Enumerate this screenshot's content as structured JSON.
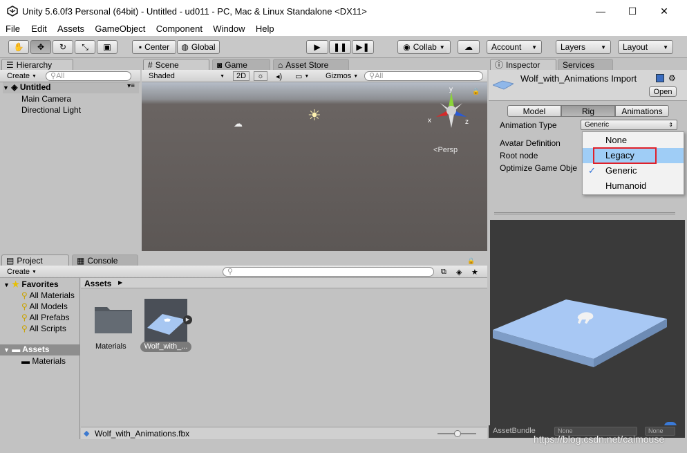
{
  "window": {
    "title": "Unity 5.6.0f3 Personal (64bit) - Untitled - ud011 - PC, Mac & Linux Standalone <DX11>",
    "minimize": "—",
    "maximize": "☐",
    "close": "✕"
  },
  "menu": [
    "File",
    "Edit",
    "Assets",
    "GameObject",
    "Component",
    "Window",
    "Help"
  ],
  "toolbar": {
    "center": "Center",
    "global": "Global",
    "collab": "Collab",
    "account": "Account",
    "layers": "Layers",
    "layout": "Layout"
  },
  "hierarchy": {
    "tab": "Hierarchy",
    "create": "Create",
    "search_placeholder": "All",
    "scene": "Untitled",
    "items": [
      "Main Camera",
      "Directional Light"
    ]
  },
  "scene": {
    "tabs": [
      "Scene",
      "Game",
      "Asset Store"
    ],
    "shading": "Shaded",
    "mode2d": "2D",
    "gizmos": "Gizmos",
    "search_placeholder": "All",
    "persp": "Persp",
    "axes": {
      "x": "x",
      "y": "y",
      "z": "z"
    }
  },
  "inspector": {
    "tabs": [
      "Inspector",
      "Services"
    ],
    "asset_title": "Wolf_with_Animations Import",
    "open": "Open",
    "subtabs": [
      "Model",
      "Rig",
      "Animations"
    ],
    "active_subtab": "Rig",
    "rows": [
      "Animation Type",
      "Avatar Definition",
      "Root node",
      "Optimize Game Obje"
    ],
    "animation_type_value": "Generic",
    "dropdown": {
      "options": [
        "None",
        "Legacy",
        "Generic",
        "Humanoid"
      ],
      "highlighted": "Legacy",
      "checked": "Generic"
    },
    "assetbundle": {
      "label": "AssetBundle",
      "value": "None",
      "variant": "None"
    }
  },
  "project": {
    "tabs": [
      "Project",
      "Console"
    ],
    "create": "Create",
    "favorites": "Favorites",
    "fav_items": [
      "All Materials",
      "All Models",
      "All Prefabs",
      "All Scripts"
    ],
    "assets": "Assets",
    "asset_children": [
      "Materials"
    ],
    "breadcrumb": "Assets",
    "grid": [
      {
        "label": "Materials"
      },
      {
        "label": "Wolf_with_..."
      }
    ],
    "footer": "Wolf_with_Animations.fbx"
  },
  "watermark": "https://blog.csdn.net/caimouse",
  "colors": {
    "accent_red": "#e0202a",
    "selection": "#9fcdf6"
  }
}
